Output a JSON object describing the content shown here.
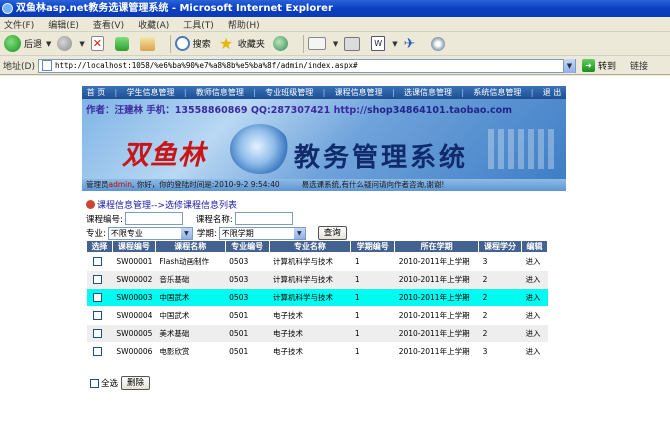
{
  "window": {
    "title": "双鱼林asp.net教务选课管理系统 - Microsoft Internet Explorer"
  },
  "menu": [
    "文件(F)",
    "编辑(E)",
    "查看(V)",
    "收藏(A)",
    "工具(T)",
    "帮助(H)"
  ],
  "toolbar": {
    "back_label": "后退",
    "search_label": "搜索",
    "favorites_label": "收藏夹"
  },
  "address": {
    "label": "地址(D)",
    "url": "http://localhost:1058/%e6%ba%90%e7%a8%8b%e5%ba%8f/admin/index.aspx#",
    "go_label": "转到",
    "links_label": "链接"
  },
  "site": {
    "nav": [
      "首 页",
      "学生信息管理",
      "教师信息管理",
      "专业班级管理",
      "课程信息管理",
      "选课信息管理",
      "系统信息管理",
      "退 出"
    ],
    "contact_prefix": "作者：汪建林  手机：13558860869 QQ:287307421  http://",
    "contact_url": "shop34864101.taobao.com",
    "logo_left": "双鱼林",
    "logo_right": "教务管理系统",
    "status_prefix": "管理员",
    "status_user": "admin",
    "status_suffix": ", 你好，你的登陆时间是:2010-9-2 9:54:40",
    "status_notice": "易选课系统,有什么疑问请向作者咨询,谢谢!"
  },
  "breadcrumb": "课程信息管理-->选修课程信息列表",
  "search": {
    "course_no_label": "课程编号:",
    "course_name_label": "课程名称:",
    "major_label": "专业:",
    "major_value": "不限专业",
    "term_label": "学期:",
    "term_value": "不限学期",
    "query_button": "查询"
  },
  "table": {
    "headers": [
      "选择",
      "课程编号",
      "课程名称",
      "专业编号",
      "专业名称",
      "学期编号",
      "所在学期",
      "课程学分",
      "编辑"
    ],
    "rows": [
      [
        "SW00001",
        "Flash动画制作",
        "0503",
        "计算机科学与技术",
        "1",
        "2010-2011年上学期",
        "3",
        "进入"
      ],
      [
        "SW00002",
        "音乐基础",
        "0503",
        "计算机科学与技术",
        "1",
        "2010-2011年上学期",
        "2",
        "进入"
      ],
      [
        "SW00003",
        "中国武术",
        "0503",
        "计算机科学与技术",
        "1",
        "2010-2011年上学期",
        "2",
        "进入"
      ],
      [
        "SW00004",
        "中国武术",
        "0501",
        "电子技术",
        "1",
        "2010-2011年上学期",
        "2",
        "进入"
      ],
      [
        "SW00005",
        "美术基础",
        "0501",
        "电子技术",
        "1",
        "2010-2011年上学期",
        "2",
        "进入"
      ],
      [
        "SW00006",
        "电影欣赏",
        "0501",
        "电子技术",
        "1",
        "2010-2011年上学期",
        "3",
        "进入"
      ]
    ],
    "highlighted_row": 2,
    "highlight_color": "#00fcf0"
  },
  "footer": {
    "select_all_label": "全选",
    "delete_button": "删除"
  }
}
